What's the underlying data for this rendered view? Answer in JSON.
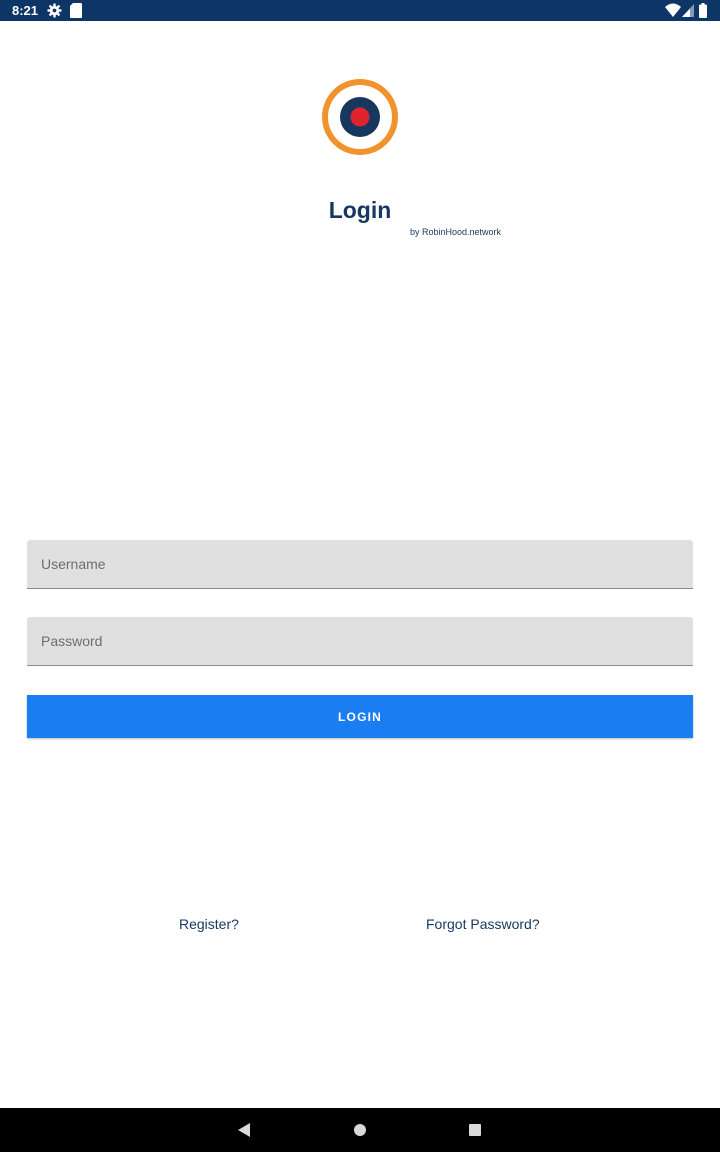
{
  "status_bar": {
    "time": "8:21",
    "left_icons": [
      "gear-icon",
      "sd-card-icon"
    ],
    "right_icons": [
      "wifi-icon",
      "signal-icon",
      "battery-icon"
    ],
    "background_color": "#0d3566"
  },
  "header": {
    "title": "Login",
    "subtitle": "by RobinHood.network",
    "logo": {
      "icon": "target-logo",
      "ring_color": "#f2922c",
      "middle_color": "#17375f",
      "center_color": "#e0242e"
    }
  },
  "form": {
    "username_placeholder": "Username",
    "username_value": "",
    "password_placeholder": "Password",
    "password_value": "",
    "login_label": "LOGIN",
    "button_color": "#1a7ef2"
  },
  "links": {
    "register": "Register?",
    "forgot_password": "Forgot Password?"
  },
  "nav_bar": {
    "buttons": [
      "back-icon",
      "home-icon",
      "recents-icon"
    ]
  }
}
